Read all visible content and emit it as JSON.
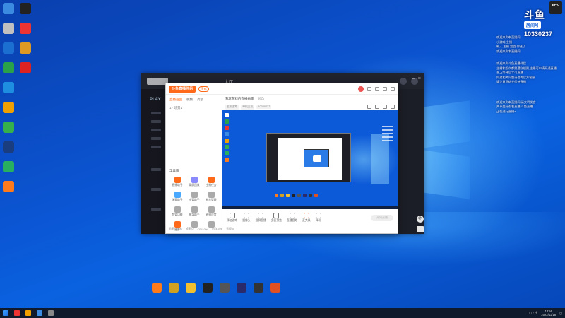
{
  "desktop": {
    "icons_left": [
      {
        "label": "",
        "color": "#3b8be0"
      },
      {
        "label": "",
        "color": "#c0c0c0"
      },
      {
        "label": "",
        "color": "#1a6fd0"
      },
      {
        "label": "",
        "color": "#2aa24a"
      },
      {
        "label": "",
        "color": "#1e8fe0"
      },
      {
        "label": "",
        "color": "#f0a000"
      },
      {
        "label": "",
        "color": "#35b04a"
      },
      {
        "label": "",
        "color": "#1a3d80"
      },
      {
        "label": "",
        "color": "#28b060"
      },
      {
        "label": "",
        "color": "#ff7a1a"
      }
    ],
    "icons_left2": [
      {
        "label": "",
        "color": "#222"
      },
      {
        "label": "",
        "color": "#e33"
      },
      {
        "label": "",
        "color": "#d92"
      },
      {
        "label": "",
        "color": "#d22"
      }
    ]
  },
  "outer_window": {
    "play_label": "PLAY",
    "nav": [
      "大厅",
      "",
      "",
      ""
    ]
  },
  "streamer_app": {
    "brand": "斗鱼直播伴侣",
    "version": "正式",
    "tabs": [
      "直播画面",
      "视频",
      "高级"
    ],
    "scene": "1 · 场景1",
    "title": "我玩游戏的直播画面",
    "title_edit": "修改",
    "chips": [
      "主机游戏",
      "单机主机",
      "10330237"
    ],
    "tools_title": "工具箱",
    "tools": [
      {
        "label": "直播助手",
        "color": "#ff6a1a"
      },
      {
        "label": "录屏回放",
        "color": "#8a8aff"
      },
      {
        "label": "主播任务",
        "color": "#ff6a1a"
      },
      {
        "label": "弹幕助手",
        "color": "#4aa8ff"
      },
      {
        "label": "房管助手",
        "color": "#aaa"
      },
      {
        "label": "粉丝管理",
        "color": "#aaa"
      },
      {
        "label": "超管功能",
        "color": "#aaa"
      },
      {
        "label": "抽奖助手",
        "color": "#aaa"
      },
      {
        "label": "直播设置",
        "color": "#aaa"
      },
      {
        "label": "更多",
        "color": "#ff6a1a"
      },
      {
        "label": "",
        "color": "#aaa"
      },
      {
        "label": "",
        "color": "#aaa"
      }
    ],
    "toolbar": [
      {
        "label": "添加游戏"
      },
      {
        "label": "摄像头"
      },
      {
        "label": "投屏直播"
      },
      {
        "label": "多区预览"
      },
      {
        "label": "直播音效"
      },
      {
        "label": "麦克风"
      },
      {
        "label": "耳机"
      }
    ],
    "start_button": "开始直播",
    "footer": [
      "码率:0kb/s",
      "帧率:0",
      "CPU:0%",
      "内存:0%",
      "丢帧:0"
    ]
  },
  "overlay": {
    "logo": "斗鱼",
    "room_label": "房间号",
    "room_number": "10330237",
    "chat_lines": [
      "欢迎来到本直播间",
      "小游戏 主播",
      "新人 主播 超管 你送了",
      "欢迎来到本直播间",
      "",
      "欢迎来到斗鱼直播伴侣",
      "主播和观众都需遵守规则,主播可申请开通直播",
      "合上等待后才可直播",
      "如遇相关问题请咨询官方客服",
      "请注意网络并保持直播",
      "",
      "",
      "欢迎来到本直播间,请文明发言",
      "共享美好观看直播,斗鱼直播",
      "正在进行直播~"
    ],
    "epic": "EPIC"
  },
  "dock": [
    {
      "label": "",
      "color": "#ff7a1a"
    },
    {
      "label": "",
      "color": "#d0a020"
    },
    {
      "label": "",
      "color": "#f0c030"
    },
    {
      "label": "",
      "color": "#222"
    },
    {
      "label": "",
      "color": "#555"
    },
    {
      "label": "",
      "color": "#2a2a6a"
    },
    {
      "label": "",
      "color": "#333"
    },
    {
      "label": "",
      "color": "#e05020"
    }
  ],
  "taskbar": {
    "time": "13:56",
    "date": "2022/11/18"
  }
}
